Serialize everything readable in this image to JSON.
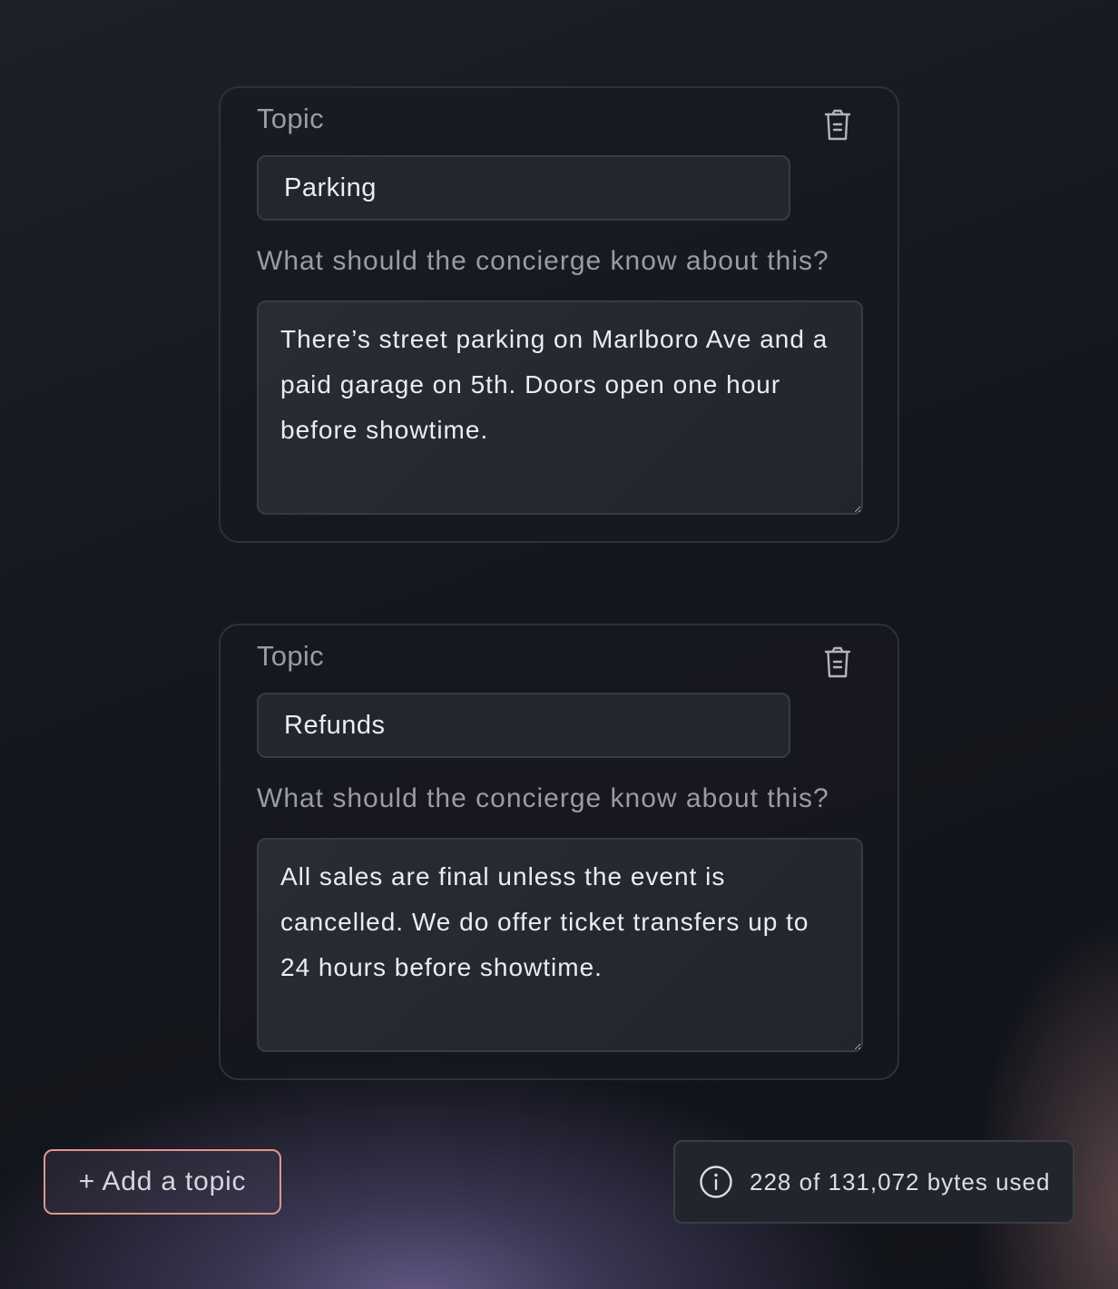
{
  "topics": [
    {
      "label": "Topic",
      "name": "Parking",
      "question": "What should the concierge know about this?",
      "notes": "There’s street parking on Marlboro Ave and a paid garage on 5th. Doors open one hour before showtime.",
      "delete_icon": "trash-icon"
    },
    {
      "label": "Topic",
      "name": "Refunds",
      "question": "What should the concierge know about this?",
      "notes": "All sales are final unless the event is cancelled. We do offer ticket transfers up to 24 hours before showtime.",
      "delete_icon": "trash-icon"
    }
  ],
  "add_topic_label": "+ Add a topic",
  "usage": {
    "icon": "info-icon",
    "text": "228 of 131,072 bytes used"
  },
  "colors": {
    "accent_border": "#e0968c",
    "muted_text": "#9c9aa6"
  }
}
